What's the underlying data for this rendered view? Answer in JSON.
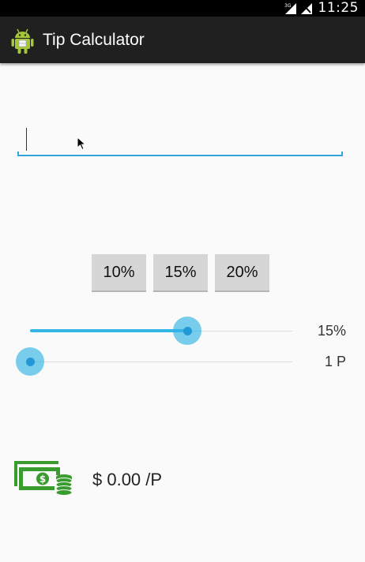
{
  "status_bar": {
    "time": "11:25",
    "network_label": "3G",
    "icons": [
      "signal-3g-icon",
      "signal-no-service-icon"
    ]
  },
  "app": {
    "title": "Tip Calculator",
    "icon": "android-icon"
  },
  "bill_input": {
    "value": "",
    "placeholder": ""
  },
  "tip_buttons": {
    "ten": "10%",
    "fifteen": "15%",
    "twenty": "20%"
  },
  "tip_slider": {
    "value_fraction": 0.6,
    "label": "15%"
  },
  "people_slider": {
    "value_fraction": 0.0,
    "label": "1 P"
  },
  "result": {
    "icon": "money-stack-icon",
    "per_person": "$ 0.00 /P"
  },
  "colors": {
    "accent": "#33b5e5",
    "action_bar": "#202020",
    "money_green": "#3a9b2f"
  }
}
